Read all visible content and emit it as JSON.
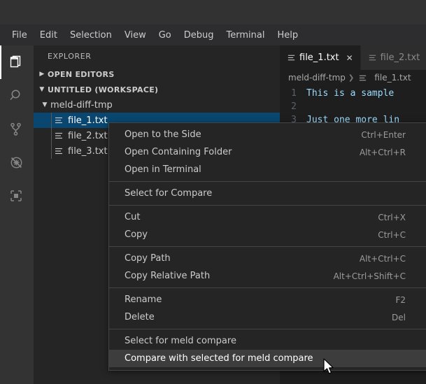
{
  "menubar": {
    "items": [
      {
        "label": "File",
        "name": "menu-file"
      },
      {
        "label": "Edit",
        "name": "menu-edit"
      },
      {
        "label": "Selection",
        "name": "menu-selection"
      },
      {
        "label": "View",
        "name": "menu-view"
      },
      {
        "label": "Go",
        "name": "menu-go"
      },
      {
        "label": "Debug",
        "name": "menu-debug"
      },
      {
        "label": "Terminal",
        "name": "menu-terminal"
      },
      {
        "label": "Help",
        "name": "menu-help"
      }
    ]
  },
  "activitybar": {
    "icons": [
      {
        "name": "explorer-icon",
        "active": true
      },
      {
        "name": "search-icon",
        "active": false
      },
      {
        "name": "source-control-icon",
        "active": false
      },
      {
        "name": "run-and-debug-icon",
        "active": false
      },
      {
        "name": "extensions-icon",
        "active": false
      }
    ]
  },
  "sidebar": {
    "title": "EXPLORER",
    "sections": [
      {
        "label": "OPEN EDITORS",
        "expanded": false
      },
      {
        "label": "UNTITLED (WORKSPACE)",
        "expanded": true
      }
    ],
    "folder": "meld-diff-tmp",
    "files": [
      {
        "label": "file_1.txt",
        "selected": true
      },
      {
        "label": "file_2.txt",
        "selected": false
      },
      {
        "label": "file_3.txt",
        "selected": false
      }
    ]
  },
  "editor": {
    "tabs": [
      {
        "label": "file_1.txt",
        "active": true,
        "close": "✕"
      },
      {
        "label": "file_2.txt",
        "active": false,
        "close": "✕"
      }
    ],
    "breadcrumb": {
      "folder": "meld-diff-tmp",
      "separator": "❯",
      "file": "file_1.txt"
    },
    "lines": [
      {
        "number": "1",
        "text": "This is a sample"
      },
      {
        "number": "2",
        "text": ""
      },
      {
        "number": "3",
        "text": "Just one more lin"
      }
    ]
  },
  "contextmenu": {
    "groups": [
      {
        "items": [
          {
            "label": "Open to the Side",
            "key": "Ctrl+Enter",
            "highlight": false
          },
          {
            "label": "Open Containing Folder",
            "key": "Alt+Ctrl+R",
            "highlight": false
          },
          {
            "label": "Open in Terminal",
            "key": "",
            "highlight": false
          }
        ]
      },
      {
        "items": [
          {
            "label": "Select for Compare",
            "key": "",
            "highlight": false
          }
        ]
      },
      {
        "items": [
          {
            "label": "Cut",
            "key": "Ctrl+X",
            "highlight": false
          },
          {
            "label": "Copy",
            "key": "Ctrl+C",
            "highlight": false
          }
        ]
      },
      {
        "items": [
          {
            "label": "Copy Path",
            "key": "Alt+Ctrl+C",
            "highlight": false
          },
          {
            "label": "Copy Relative Path",
            "key": "Alt+Ctrl+Shift+C",
            "highlight": false
          }
        ]
      },
      {
        "items": [
          {
            "label": "Rename",
            "key": "F2",
            "highlight": false
          },
          {
            "label": "Delete",
            "key": "Del",
            "highlight": false
          }
        ]
      },
      {
        "items": [
          {
            "label": "Select for meld compare",
            "key": "",
            "highlight": false
          },
          {
            "label": "Compare with selected for meld compare",
            "key": "",
            "highlight": true
          }
        ]
      }
    ]
  },
  "colors": {
    "accent_selection": "#094771",
    "sidebar_bg": "#252526",
    "activitybar_bg": "#333333",
    "editor_bg": "#1e1e1e",
    "menu_highlight": "#3d3d3d",
    "code_text": "#9cdcfe"
  }
}
